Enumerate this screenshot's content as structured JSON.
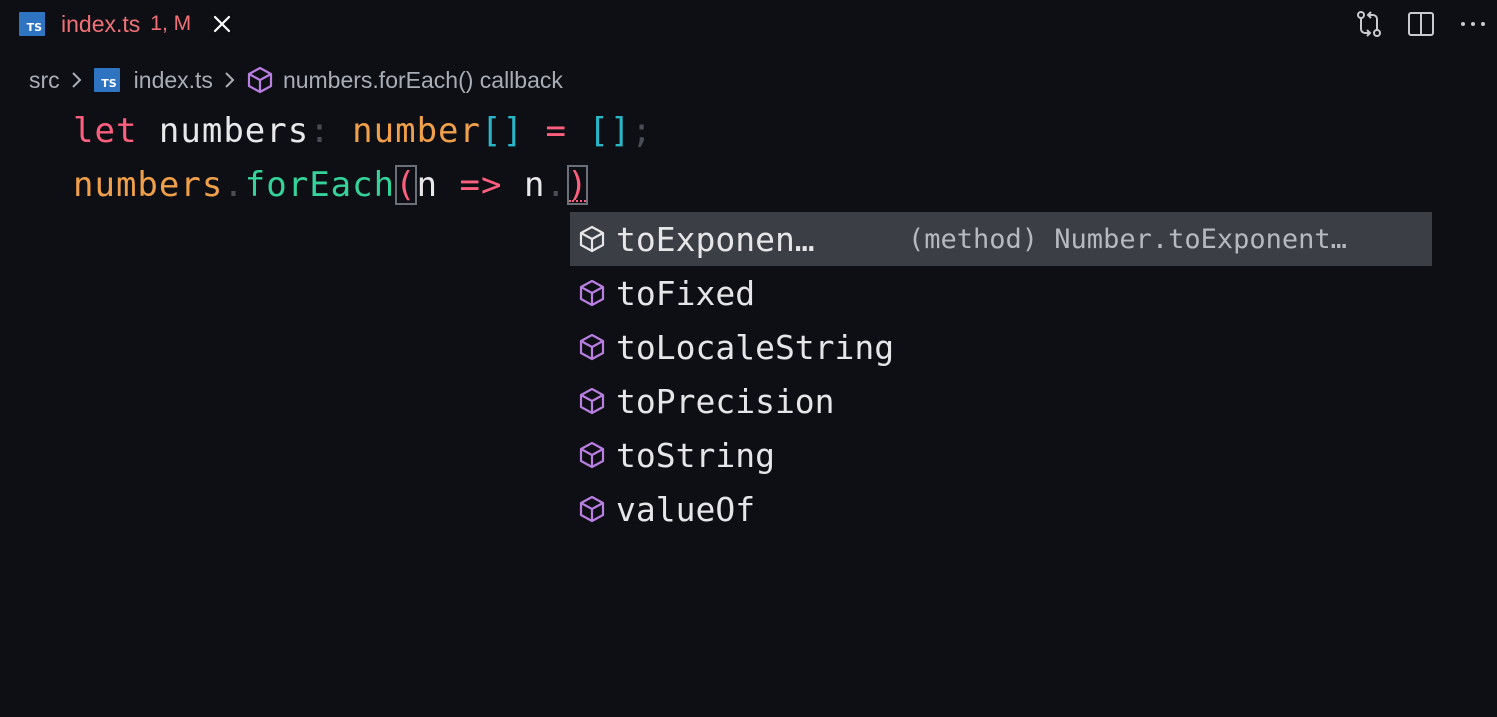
{
  "tab": {
    "badge": "TS",
    "filename": "index.ts",
    "status": "1, M"
  },
  "actions": [
    "git-compare-icon",
    "split-editor-icon",
    "more-actions-icon"
  ],
  "breadcrumb": {
    "folder": "src",
    "file_badge": "TS",
    "file": "index.ts",
    "symbol": "numbers.forEach() callback"
  },
  "code": {
    "line1": {
      "kw": "let",
      "name": "numbers",
      "colon": ":",
      "type": "number",
      "brackets": "[]",
      "eq": "=",
      "init": "[]",
      "semi": ";"
    },
    "line2": {
      "obj": "numbers",
      "dot1": ".",
      "method": "forEach",
      "open": "(",
      "param": "n",
      "arrow": "=>",
      "ref": "n",
      "dot2": ".",
      "close": ")"
    }
  },
  "suggestions": [
    {
      "label": "toExponen…",
      "detail": "(method) Number.toExponent…",
      "selected": true
    },
    {
      "label": "toFixed"
    },
    {
      "label": "toLocaleString"
    },
    {
      "label": "toPrecision"
    },
    {
      "label": "toString"
    },
    {
      "label": "valueOf"
    }
  ],
  "colors": {
    "background": "#0e0f14",
    "tab_text": "#f07178",
    "ts_badge": "#2f74c0",
    "method_icon": "#b87ee0",
    "selected_row": "#3b3e45"
  }
}
